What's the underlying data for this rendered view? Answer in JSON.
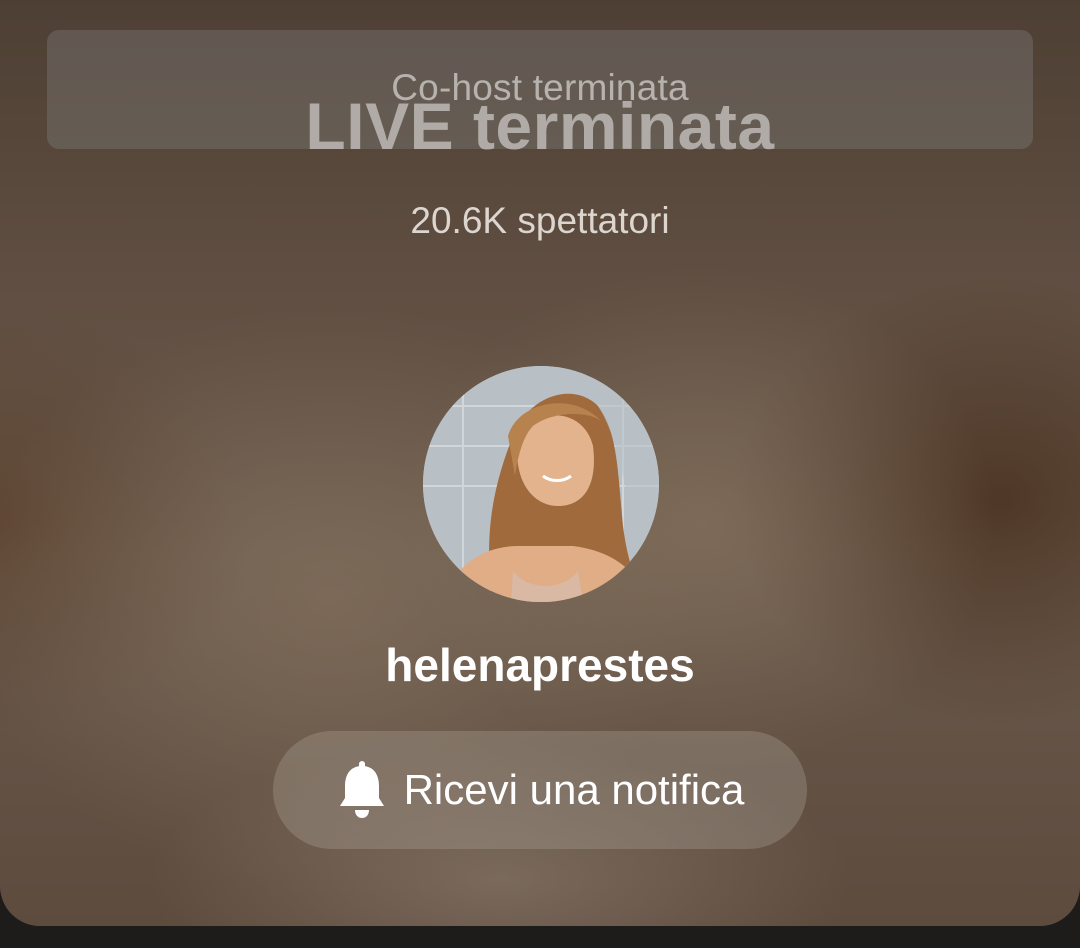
{
  "banner": {
    "text": "Co-host terminata"
  },
  "live": {
    "title": "LIVE terminata",
    "viewers": "20.6K spettatori"
  },
  "host": {
    "username": "helenaprestes",
    "avatar_icon": "profile-photo"
  },
  "notify_button": {
    "label": "Ricevi una notifica",
    "icon": "bell-icon"
  },
  "colors": {
    "background_tone": "#5f4e41",
    "text_primary": "#ffffff",
    "text_secondary": "#dcd6cf"
  }
}
